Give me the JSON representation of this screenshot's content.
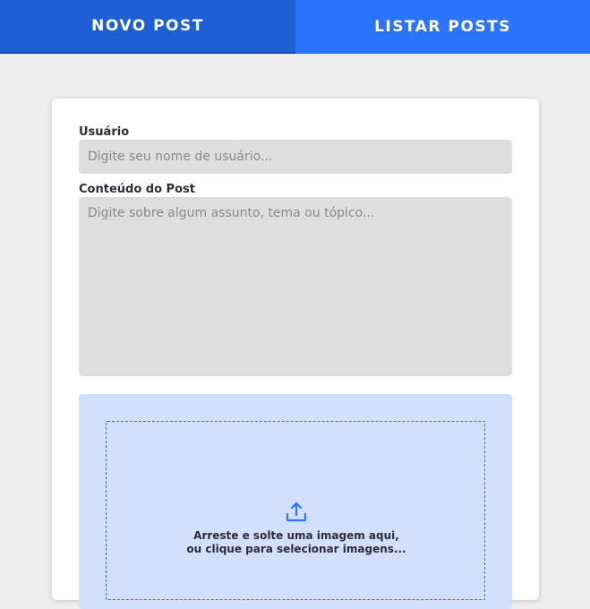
{
  "tabs": {
    "new_post": "NOVO POST",
    "list_posts": "LISTAR POSTS"
  },
  "form": {
    "user_label": "Usuário",
    "user_placeholder": "Digite seu nome de usuário...",
    "content_label": "Conteúdo do Post",
    "content_placeholder": "Digite sobre algum assunto, tema ou tópico..."
  },
  "upload": {
    "icon": "upload-icon",
    "line1": "Arreste e solte uma imagem aqui,",
    "line2": "ou clique para selecionar imagens..."
  },
  "colors": {
    "tab_active": "#1f5fd6",
    "tab_inactive": "#2b74ff",
    "upload_bg": "#d3e0fd",
    "accent": "#3a6fd8"
  }
}
